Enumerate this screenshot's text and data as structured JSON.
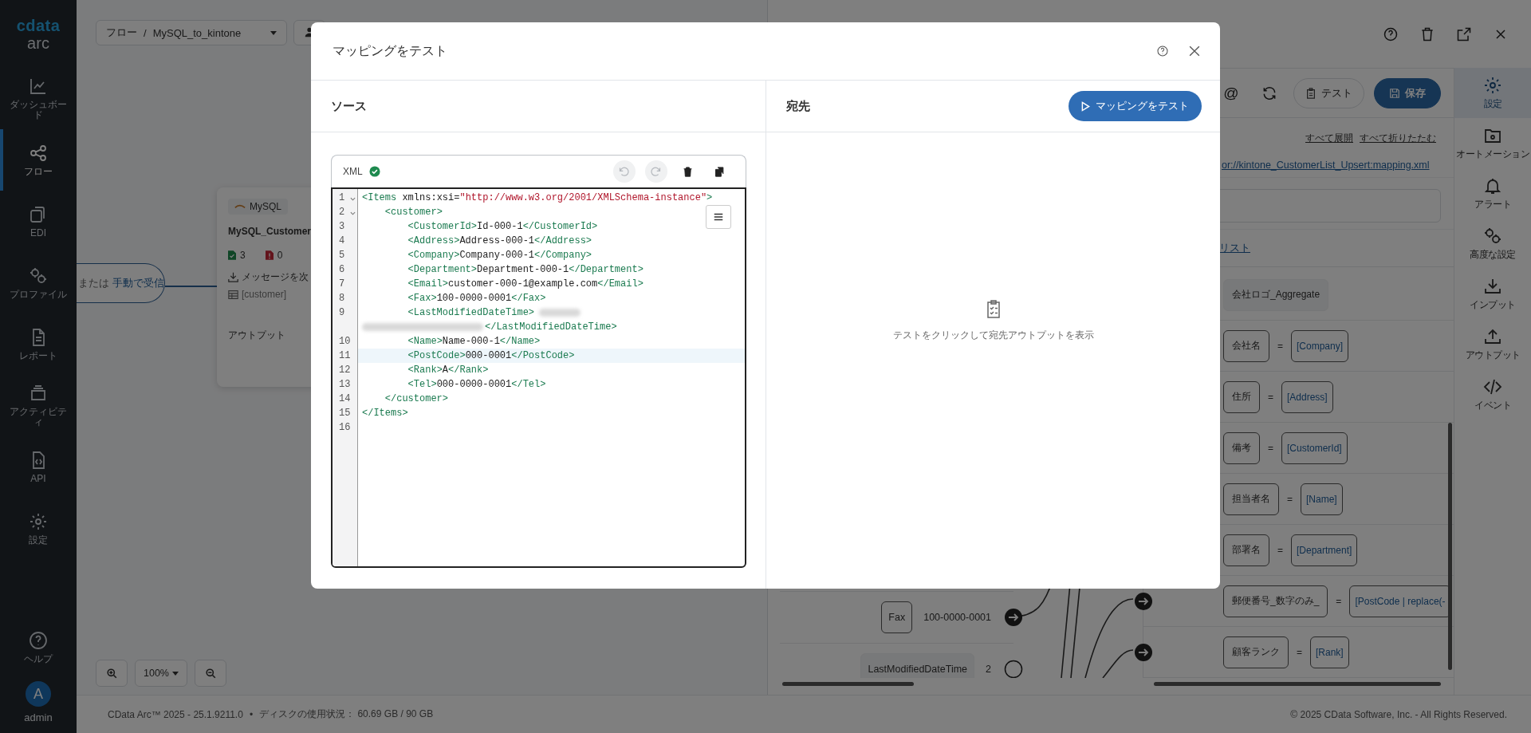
{
  "sidebar": {
    "logo": "cdata",
    "product": "arc",
    "items": [
      {
        "label": "ダッシュボード",
        "selected": false
      },
      {
        "label": "フロー",
        "selected": true
      },
      {
        "label": "EDI",
        "selected": false
      },
      {
        "label": "プロファイル",
        "selected": false
      },
      {
        "label": "レポート",
        "selected": false
      },
      {
        "label": "アクティビティ",
        "selected": false
      },
      {
        "label": "API",
        "selected": false
      },
      {
        "label": "設定",
        "selected": false
      }
    ],
    "help": "ヘルプ",
    "user": {
      "initial": "A",
      "name": "admin"
    }
  },
  "flow": {
    "breadcrumb": {
      "section": "フロー",
      "separator": "/",
      "name": "MySQL_to_kintone"
    },
    "trigger": {
      "text": "または",
      "link": "手動で受信"
    },
    "node": {
      "badge": "MySQL",
      "name": "MySQL_Customer",
      "success_count": "3",
      "error_count": "0",
      "action": "メッセージを次",
      "table": "[customer]",
      "section": "アウトプット"
    },
    "zoom": "100%"
  },
  "panel": {
    "at_symbol": "@",
    "test_button": "テスト",
    "save_button": "保存",
    "expand_all": "すべて展開",
    "collapse_all": "すべて折りたたむ",
    "mapping_file": "or://kintone_CustomerList_Upsert:mapping.xml",
    "list_link": "リスト",
    "source_rows": [
      {
        "field": "Fax",
        "value": "100-0000-0001",
        "mapped": true
      },
      {
        "field": "LastModifiedDateTime",
        "value": "2",
        "mapped": false
      }
    ],
    "target_rows": [
      {
        "kind": "aggregate",
        "field": "会社ロゴ_Aggregate"
      },
      {
        "kind": "mapping",
        "field": "会社名",
        "operator": "=",
        "expression": "[Company]"
      },
      {
        "kind": "mapping",
        "field": "住所",
        "operator": "=",
        "expression": "[Address]"
      },
      {
        "kind": "mapping",
        "field": "備考",
        "operator": "=",
        "expression": "[CustomerId]"
      },
      {
        "kind": "mapping",
        "field": "担当者名",
        "operator": "=",
        "expression": "[Name]"
      },
      {
        "kind": "mapping",
        "field": "部署名",
        "operator": "=",
        "expression": "[Department]"
      },
      {
        "kind": "mapping",
        "field": "郵便番号_数字のみ_",
        "operator": "=",
        "expression": "[PostCode | replace(-"
      },
      {
        "kind": "mapping",
        "field": "顧客ランク",
        "operator": "=",
        "expression": "[Rank]"
      }
    ],
    "nav": [
      {
        "label": "設定",
        "selected": true
      },
      {
        "label": "オートメーション",
        "selected": false
      },
      {
        "label": "アラート",
        "selected": false
      },
      {
        "label": "高度な設定",
        "selected": false
      },
      {
        "label": "インプット",
        "selected": false
      },
      {
        "label": "アウトプット",
        "selected": false
      },
      {
        "label": "イベント",
        "selected": false
      }
    ]
  },
  "status_bar": {
    "version": "CData Arc™ 2025 - 25.1.9211.0",
    "separator": "•",
    "disk": "ディスクの使用状況： 60.69 GB / 90 GB",
    "copyright": "© 2025 CData Software, Inc. - All Rights Reserved."
  },
  "dialog": {
    "title": "マッピングをテスト",
    "source": {
      "heading": "ソース",
      "editor": {
        "language": "XML",
        "valid": true,
        "actions": [
          {
            "disabled": true
          },
          {
            "disabled": true
          },
          {
            "disabled": false
          },
          {
            "disabled": false
          }
        ],
        "lines": [
          {
            "number": "1",
            "text": "<Items xmlns:xsi=\"http://www.w3.org/2001/XMLSchema-instance\">",
            "foldable": true,
            "active": false,
            "redacted": false
          },
          {
            "number": "2",
            "text": "    <customer>",
            "foldable": true,
            "active": false,
            "redacted": false
          },
          {
            "number": "3",
            "text": "        <CustomerId>Id-000-1</CustomerId>",
            "foldable": false,
            "active": false,
            "redacted": false
          },
          {
            "number": "4",
            "text": "        <Address>Address-000-1</Address>",
            "foldable": false,
            "active": false,
            "redacted": false
          },
          {
            "number": "5",
            "text": "        <Company>Company-000-1</Company>",
            "foldable": false,
            "active": false,
            "redacted": false
          },
          {
            "number": "6",
            "text": "        <Department>Department-000-1</Department>",
            "foldable": false,
            "active": false,
            "redacted": false
          },
          {
            "number": "7",
            "text": "        <Email>customer-000-1@example.com</Email>",
            "foldable": false,
            "active": false,
            "redacted": false
          },
          {
            "number": "8",
            "text": "        <Fax>100-0000-0001</Fax>",
            "foldable": false,
            "active": false,
            "redacted": false
          },
          {
            "number": "9",
            "text": "        <LastModifiedDateTime>",
            "text_end": "</LastModifiedDateTime>",
            "foldable": false,
            "active": false,
            "redacted": true
          },
          {
            "number": "10",
            "text": "        <Name>Name-000-1</Name>",
            "foldable": false,
            "active": false,
            "redacted": false
          },
          {
            "number": "11",
            "text": "        <PostCode>000-0001</PostCode>",
            "foldable": false,
            "active": true,
            "redacted": false
          },
          {
            "number": "12",
            "text": "        <Rank>A</Rank>",
            "foldable": false,
            "active": false,
            "redacted": false
          },
          {
            "number": "13",
            "text": "        <Tel>000-0000-0001</Tel>",
            "foldable": false,
            "active": false,
            "redacted": false
          },
          {
            "number": "14",
            "text": "    </customer>",
            "foldable": false,
            "active": false,
            "redacted": false
          },
          {
            "number": "15",
            "text": "</Items>",
            "foldable": false,
            "active": false,
            "redacted": false
          },
          {
            "number": "16",
            "foldable": false,
            "active": false,
            "redacted": false
          }
        ]
      }
    },
    "destination": {
      "heading": "宛先",
      "run_button": "マッピングをテスト",
      "empty_message": "テストをクリックして宛先アウトプットを表示"
    }
  }
}
